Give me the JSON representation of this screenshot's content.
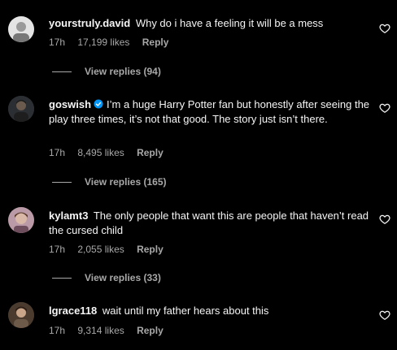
{
  "comments": [
    {
      "username": "yourstruly.david",
      "verified": false,
      "text": "Why do i have a feeling it will be a mess",
      "time": "17h",
      "likes": "17,199 likes",
      "reply": "Reply",
      "view_replies": "View replies (94)",
      "avatar_color": "#d8d8d8"
    },
    {
      "username": "goswish",
      "verified": true,
      "text": "I’m a huge Harry Potter fan but honestly after seeing the play three times, it’s not that good. The story just isn’t there.",
      "time": "17h",
      "likes": "8,495 likes",
      "reply": "Reply",
      "view_replies": "View replies (165)",
      "avatar_color": "#3a3f44"
    },
    {
      "username": "kylamt3",
      "verified": false,
      "text": "The only people that want this are people that haven’t read the cursed child",
      "time": "17h",
      "likes": "2,055 likes",
      "reply": "Reply",
      "view_replies": "View replies (33)",
      "avatar_color": "#8a6f7a"
    },
    {
      "username": "lgrace118",
      "verified": false,
      "text": "wait until my father hears about this",
      "time": "17h",
      "likes": "9,314 likes",
      "reply": "Reply",
      "avatar_color": "#5a4a3a"
    }
  ],
  "icons": {
    "heart": "heart-outline-icon",
    "verified": "verified-badge-icon"
  },
  "colors": {
    "background": "#000000",
    "text": "#f5f5f5",
    "secondary": "#a8a8a8",
    "verified": "#0095f6"
  }
}
